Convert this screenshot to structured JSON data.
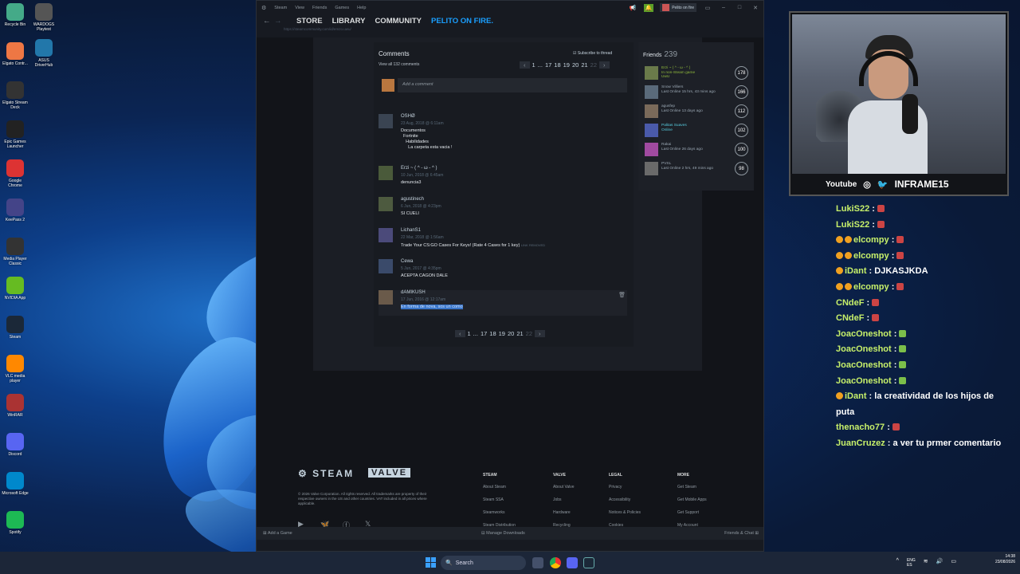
{
  "desktop": {
    "icons_left": [
      "Recycle Bin",
      "Elgato Contr...",
      "Elgato Stream Deck",
      "Epic Games Launcher",
      "Google Chrome",
      "KeePass 2",
      "Media Player Classic",
      "NVIDIA App",
      "Steam",
      "VLC media player",
      "WinRAR",
      "Discord",
      "Microsoft Edge",
      "Spotify"
    ],
    "icons_right": [
      "WARDOGS Playtest",
      "ASUS DriverHub"
    ]
  },
  "steam": {
    "menu": [
      "Steam",
      "View",
      "Friends",
      "Games",
      "Help"
    ],
    "user": "Pelito on fire",
    "nav": [
      "STORE",
      "LIBRARY",
      "COMMUNITY",
      "PELITO ON FIRE."
    ],
    "url": "https://steamcommunity.com/id/emzo.uwu/",
    "comments": {
      "title": "Comments",
      "view_all": "View all 132 comments",
      "subscribe": "Subscribe to thread",
      "add_placeholder": "Add a comment",
      "pager": [
        "1",
        "...",
        "17",
        "18",
        "19",
        "20",
        "21",
        "22"
      ],
      "items": [
        {
          "name": "OSHØ",
          "date": "23 Aug, 2018 @ 6:11am",
          "text": "Documentos\n  Fortnite\n    Habilidades\n      La carpeta esta vacia !"
        },
        {
          "name": "Erzi ~ ( ^ - ω - ^ )",
          "date": "10 Jun, 2018 @ 6:45am",
          "text": "denuncia3"
        },
        {
          "name": "agustinech",
          "date": "6 Jun, 2018 @ 4:23pm",
          "text": "SI CUELI"
        },
        {
          "name": "LichanS1",
          "date": "22 Mar, 2018 @ 1:56am",
          "text": "Trade Your CS:GO Cases For Keys! (Rate 4 Cases for 1 key)",
          "note": "LINK REMOVED"
        },
        {
          "name": "Cewa",
          "date": "5 Jun, 2017 @ 4:35pm",
          "text": "ACEPTA CAGON DALE"
        },
        {
          "name": "dAMIKUSH",
          "date": "17 Jun, 2016 @ 12:17am",
          "text": "En forma de nova, sos un como"
        }
      ]
    },
    "friends": {
      "title": "Friends",
      "count": "239",
      "items": [
        {
          "name": "Erzi ~ ( ^ - ω - ^ )",
          "status": "In non-Steam game\nUwU",
          "level": "178",
          "color": "#90ba3c"
        },
        {
          "name": "Snow Villiers",
          "status": "Last Online 15 hrs, 43 mins ago",
          "level": "166",
          "color": "#9aa7b3"
        },
        {
          "name": "agusfep",
          "status": "Last Online 13 days ago",
          "level": "112",
          "color": "#9aa7b3"
        },
        {
          "name": "Palitas Suaves",
          "status": "Online",
          "level": "102",
          "color": "#57cbde"
        },
        {
          "name": "Rakai",
          "status": "Last Online 26 days ago",
          "level": "100",
          "color": "#9aa7b3"
        },
        {
          "name": "PVSL",
          "status": "Last Online 2 hrs, 49 mins ago",
          "level": "98",
          "color": "#9aa7b3"
        }
      ]
    },
    "footer": {
      "steam_logo": "STEAM",
      "valve_logo": "VALVE",
      "copyright": "© 2026 Valve Corporation. All rights reserved. All trademarks are property of their respective owners in the US and other countries. VAT included in all prices where applicable.",
      "columns": [
        {
          "heading": "STEAM",
          "links": [
            "About Steam",
            "Steam SSA",
            "Steamworks",
            "Steam Distribution"
          ]
        },
        {
          "heading": "VALVE",
          "links": [
            "About Valve",
            "Jobs",
            "Hardware",
            "Recycling"
          ]
        },
        {
          "heading": "LEGAL",
          "links": [
            "Privacy",
            "Accessibility",
            "Notices & Policies",
            "Cookies"
          ]
        },
        {
          "heading": "MORE",
          "links": [
            "Get Steam",
            "Get Mobile Apps",
            "Get Support",
            "My Account"
          ]
        }
      ]
    },
    "bottom": {
      "add_game": "Add a Game",
      "manage_downloads": "Manage Downloads",
      "friends_chat": "Friends & Chat"
    }
  },
  "stream": {
    "social_youtube": "Youtube",
    "handle": "INFRAME15",
    "chat": [
      {
        "user": "LukiS22",
        "msg": "",
        "badges": 0
      },
      {
        "user": "LukiS22",
        "msg": "",
        "badges": 0
      },
      {
        "user": "elcompy",
        "msg": "",
        "badges": 2
      },
      {
        "user": "elcompy",
        "msg": "",
        "badges": 2
      },
      {
        "user": "iDant",
        "msg": "DJKASJKDA",
        "badges": 1
      },
      {
        "user": "elcompy",
        "msg": "",
        "badges": 2
      },
      {
        "user": "CNdeF",
        "msg": "",
        "badges": 0
      },
      {
        "user": "CNdeF",
        "msg": "",
        "badges": 0
      },
      {
        "user": "JoacOneshot",
        "msg": "",
        "badges": 0
      },
      {
        "user": "JoacOneshot",
        "msg": "",
        "badges": 0
      },
      {
        "user": "JoacOneshot",
        "msg": "",
        "badges": 0
      },
      {
        "user": "JoacOneshot",
        "msg": "",
        "badges": 0
      },
      {
        "user": "iDant",
        "msg": "la creatividad de los hijos de",
        "badges": 1
      },
      {
        "user": "",
        "msg": "puta",
        "badges": 0
      },
      {
        "user": "thenacho77",
        "msg": "",
        "badges": 0
      },
      {
        "user": "JuanCruzez",
        "msg": "a ver tu prmer comentario",
        "badges": 0
      }
    ]
  },
  "taskbar": {
    "search": "Search",
    "lang": "ENG\nES",
    "time": "14:38",
    "date": "23/08/2026"
  }
}
